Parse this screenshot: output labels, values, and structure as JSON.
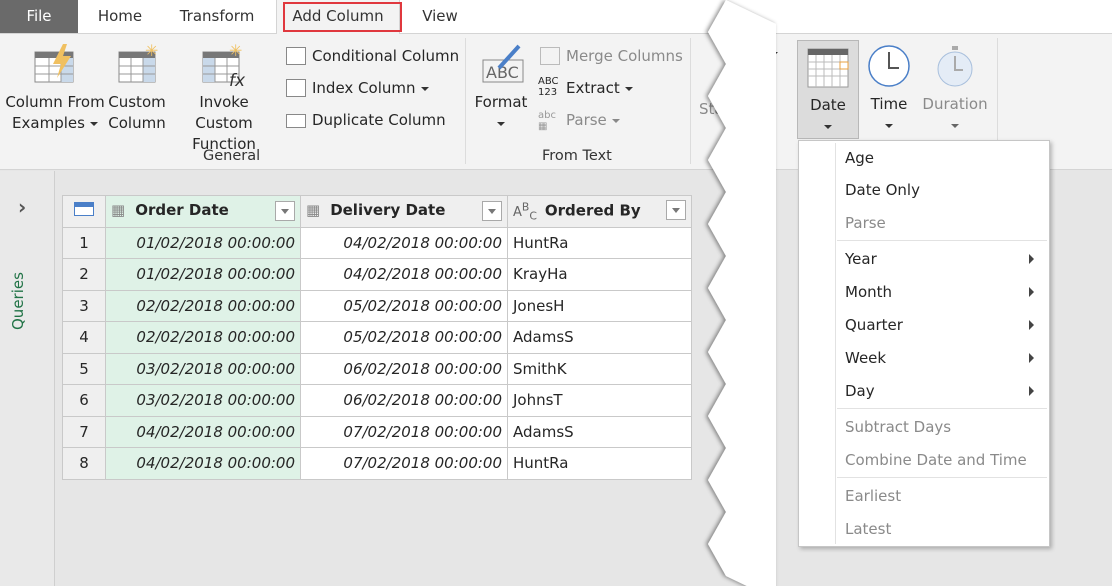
{
  "tabs": [
    "File",
    "Home",
    "Transform",
    "Add Column",
    "View"
  ],
  "active_tab": "Add Column",
  "highlight_color": "#e0383e",
  "ribbon": {
    "general": {
      "label": "General",
      "column_from_examples": [
        "Column From",
        "Examples"
      ],
      "custom_column": [
        "Custom",
        "Column"
      ],
      "invoke_custom_function": [
        "Invoke Custom",
        "Function"
      ],
      "conditional_column": "Conditional Column",
      "index_column": "Index Column",
      "duplicate_column": "Duplicate Column"
    },
    "from_text": {
      "label": "From Text",
      "format": "Format",
      "merge_columns": "Merge Columns",
      "extract": "Extract",
      "parse": "Parse"
    },
    "partial_label": "Sta",
    "date": "Date",
    "time": "Time",
    "duration": "Duration"
  },
  "queries_pane": {
    "label": "Queries"
  },
  "table": {
    "columns": [
      {
        "name": "Order Date",
        "type": "datetime"
      },
      {
        "name": "Delivery Date",
        "type": "datetime"
      },
      {
        "name": "Ordered By",
        "type": "text"
      }
    ],
    "rows": [
      [
        "1",
        "01/02/2018 00:00:00",
        "04/02/2018 00:00:00",
        "HuntRa"
      ],
      [
        "2",
        "01/02/2018 00:00:00",
        "04/02/2018 00:00:00",
        "KrayHa"
      ],
      [
        "3",
        "02/02/2018 00:00:00",
        "05/02/2018 00:00:00",
        "JonesH"
      ],
      [
        "4",
        "02/02/2018 00:00:00",
        "05/02/2018 00:00:00",
        "AdamsS"
      ],
      [
        "5",
        "03/02/2018 00:00:00",
        "06/02/2018 00:00:00",
        "SmithK"
      ],
      [
        "6",
        "03/02/2018 00:00:00",
        "06/02/2018 00:00:00",
        "JohnsT"
      ],
      [
        "7",
        "04/02/2018 00:00:00",
        "07/02/2018 00:00:00",
        "AdamsS"
      ],
      [
        "8",
        "04/02/2018 00:00:00",
        "07/02/2018 00:00:00",
        "HuntRa"
      ]
    ]
  },
  "date_menu": {
    "items": [
      {
        "label": "Age",
        "enabled": true,
        "submenu": false
      },
      {
        "label": "Date Only",
        "enabled": true,
        "submenu": false
      },
      {
        "label": "Parse",
        "enabled": false,
        "submenu": false
      },
      {
        "label": "Year",
        "enabled": true,
        "submenu": true
      },
      {
        "label": "Month",
        "enabled": true,
        "submenu": true
      },
      {
        "label": "Quarter",
        "enabled": true,
        "submenu": true
      },
      {
        "label": "Week",
        "enabled": true,
        "submenu": true
      },
      {
        "label": "Day",
        "enabled": true,
        "submenu": true
      },
      {
        "label": "Subtract Days",
        "enabled": false,
        "submenu": false
      },
      {
        "label": "Combine Date and Time",
        "enabled": false,
        "submenu": false
      },
      {
        "label": "Earliest",
        "enabled": false,
        "submenu": false
      },
      {
        "label": "Latest",
        "enabled": false,
        "submenu": false
      }
    ]
  }
}
